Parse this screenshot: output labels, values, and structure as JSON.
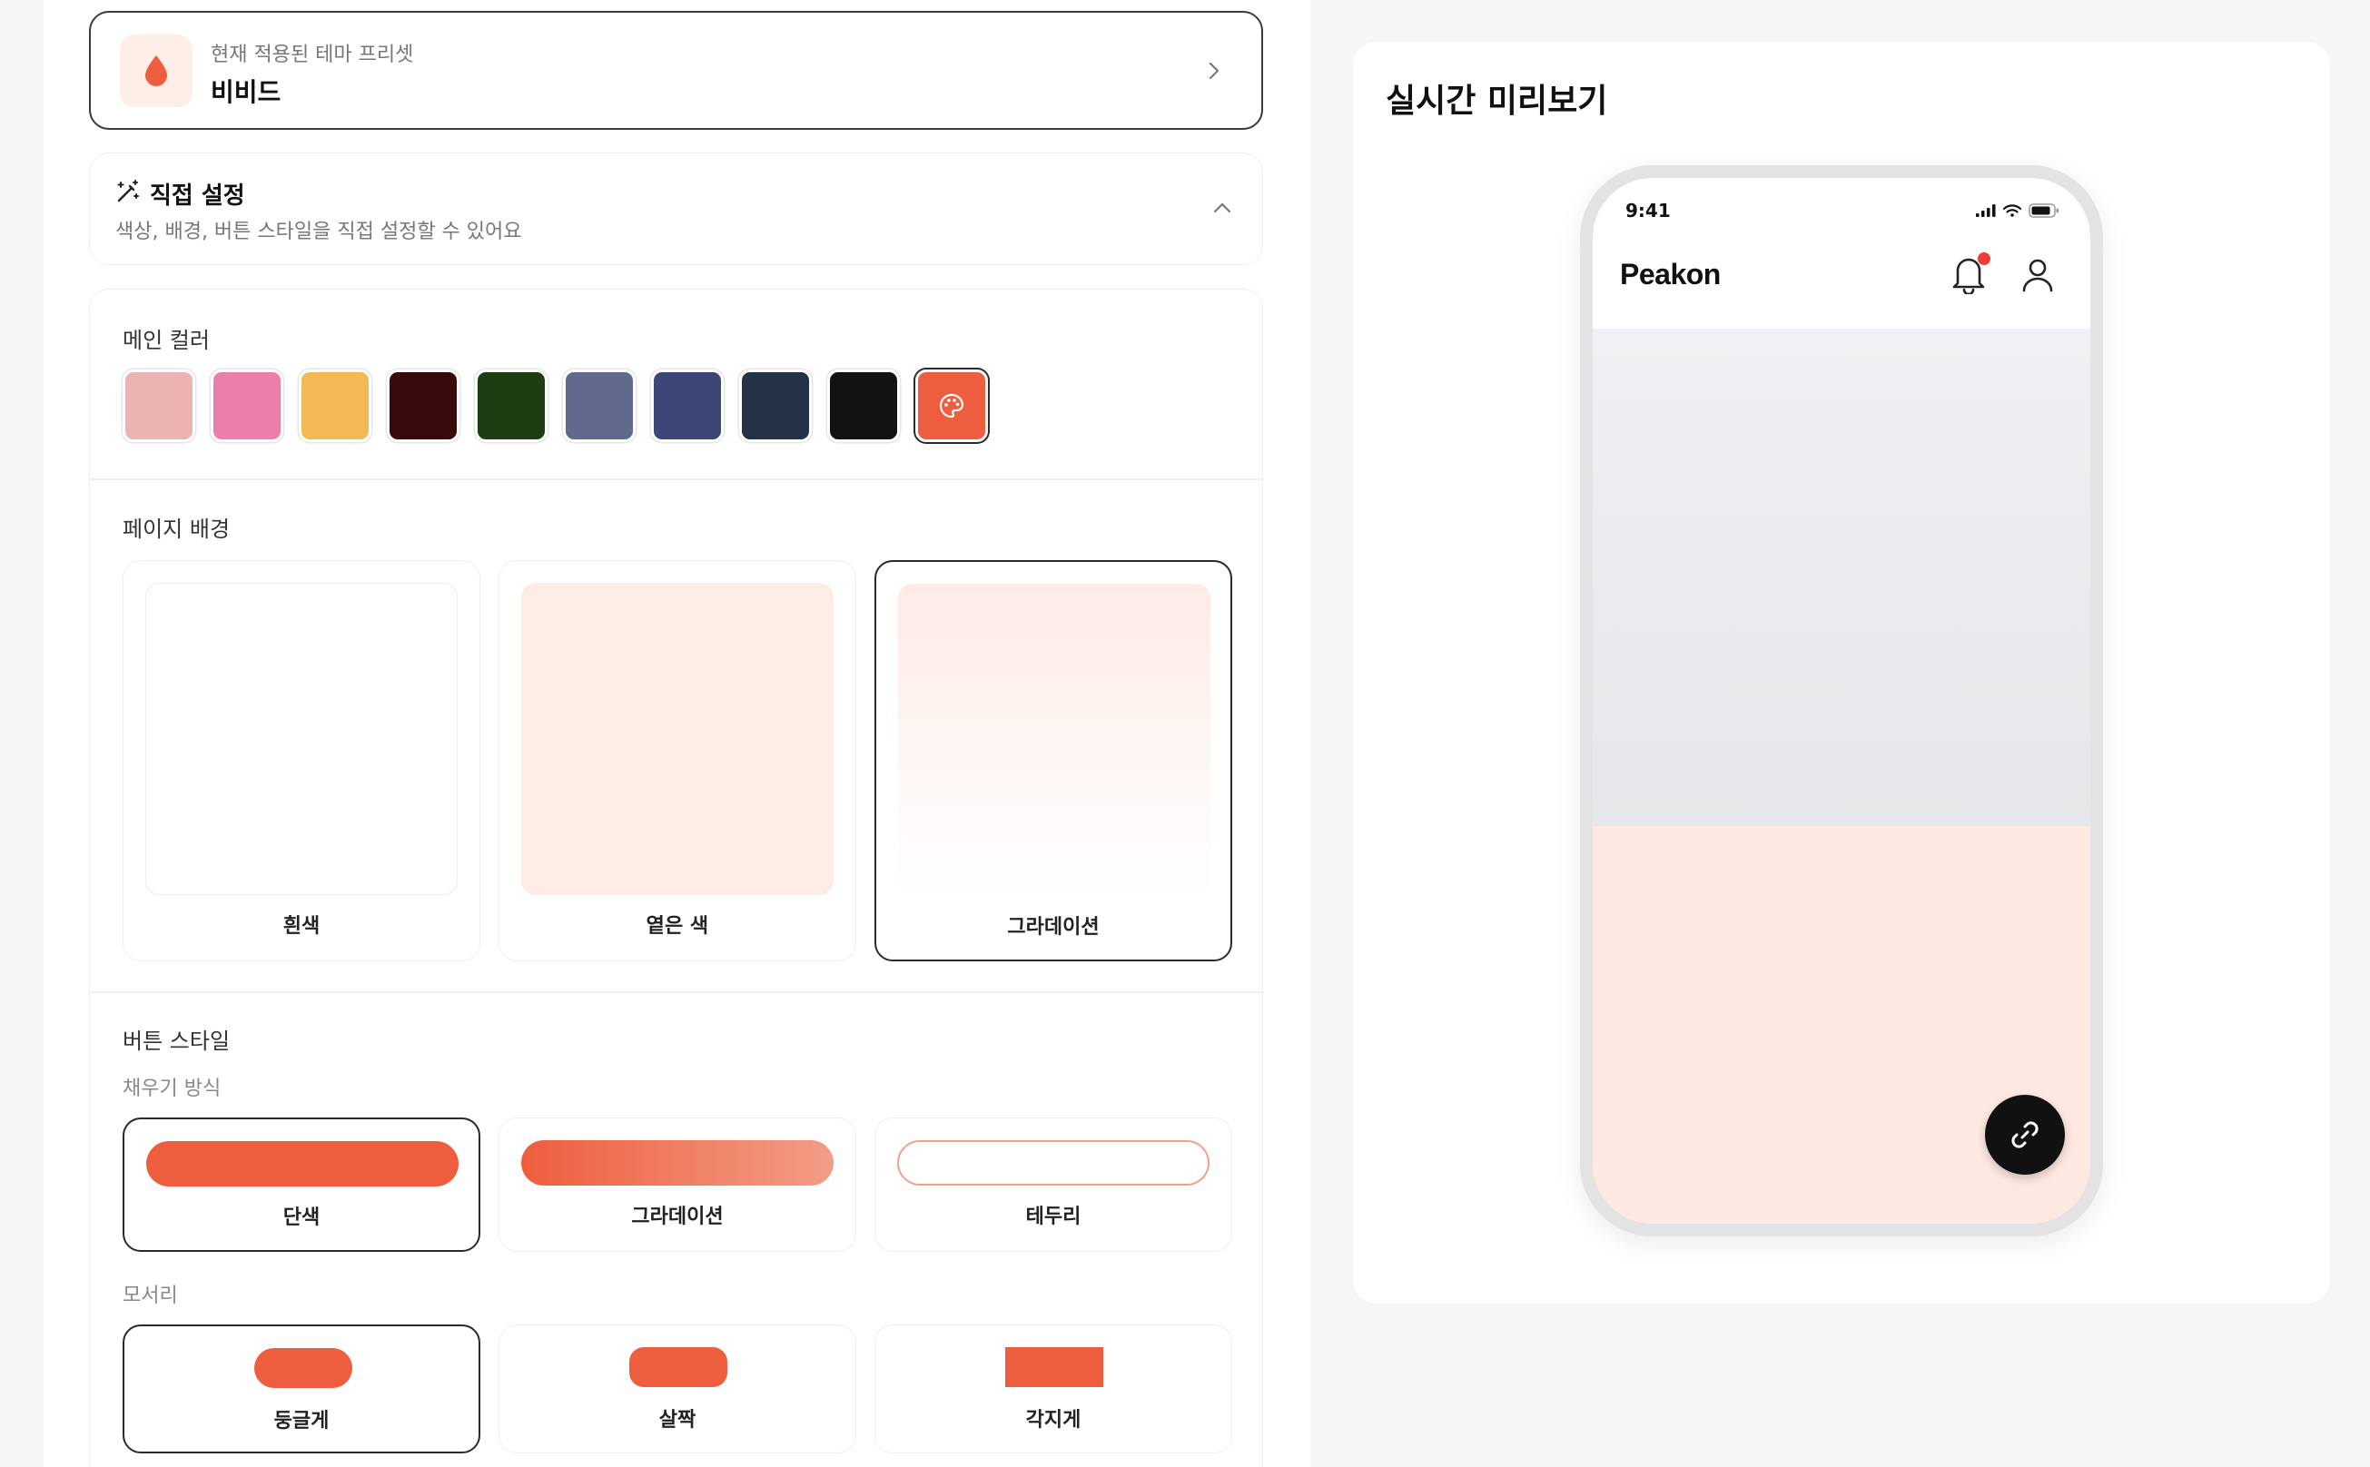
{
  "preset": {
    "subtitle": "현재 적용된 테마 프리셋",
    "name": "비비드",
    "icon": "drop-icon",
    "icon_color": "#ee5e3e"
  },
  "custom": {
    "title": "직접 설정",
    "description": "색상, 배경, 버튼 스타일을 직접 설정할 수 있어요",
    "icon": "magic-wand-icon"
  },
  "main_color": {
    "label": "메인 컬러",
    "swatches": [
      "#ecb3b3",
      "#ea7fab",
      "#f2b955",
      "#3a0909",
      "#1e3d13",
      "#606a8d",
      "#3c4677",
      "#243247",
      "#121212",
      "#ee5e3e"
    ],
    "selected_index": 9,
    "custom_icon": "palette-icon"
  },
  "page_background": {
    "label": "페이지 배경",
    "options": [
      {
        "label": "흰색"
      },
      {
        "label": "옅은 색"
      },
      {
        "label": "그라데이션"
      }
    ],
    "selected_index": 2
  },
  "button_style": {
    "label": "버튼 스타일",
    "fill_label": "채우기 방식",
    "fill_options": [
      {
        "label": "단색"
      },
      {
        "label": "그라데이션"
      },
      {
        "label": "테두리"
      }
    ],
    "fill_selected_index": 0,
    "corner_label": "모서리",
    "corner_options": [
      {
        "label": "둥글게"
      },
      {
        "label": "살짝"
      },
      {
        "label": "각지게"
      }
    ],
    "corner_selected_index": 0
  },
  "preview": {
    "title": "실시간 미리보기",
    "status_time": "9:41",
    "app_name": "Peakon",
    "accent": "#ee5e3e",
    "background_tint": "#fde8e2"
  }
}
